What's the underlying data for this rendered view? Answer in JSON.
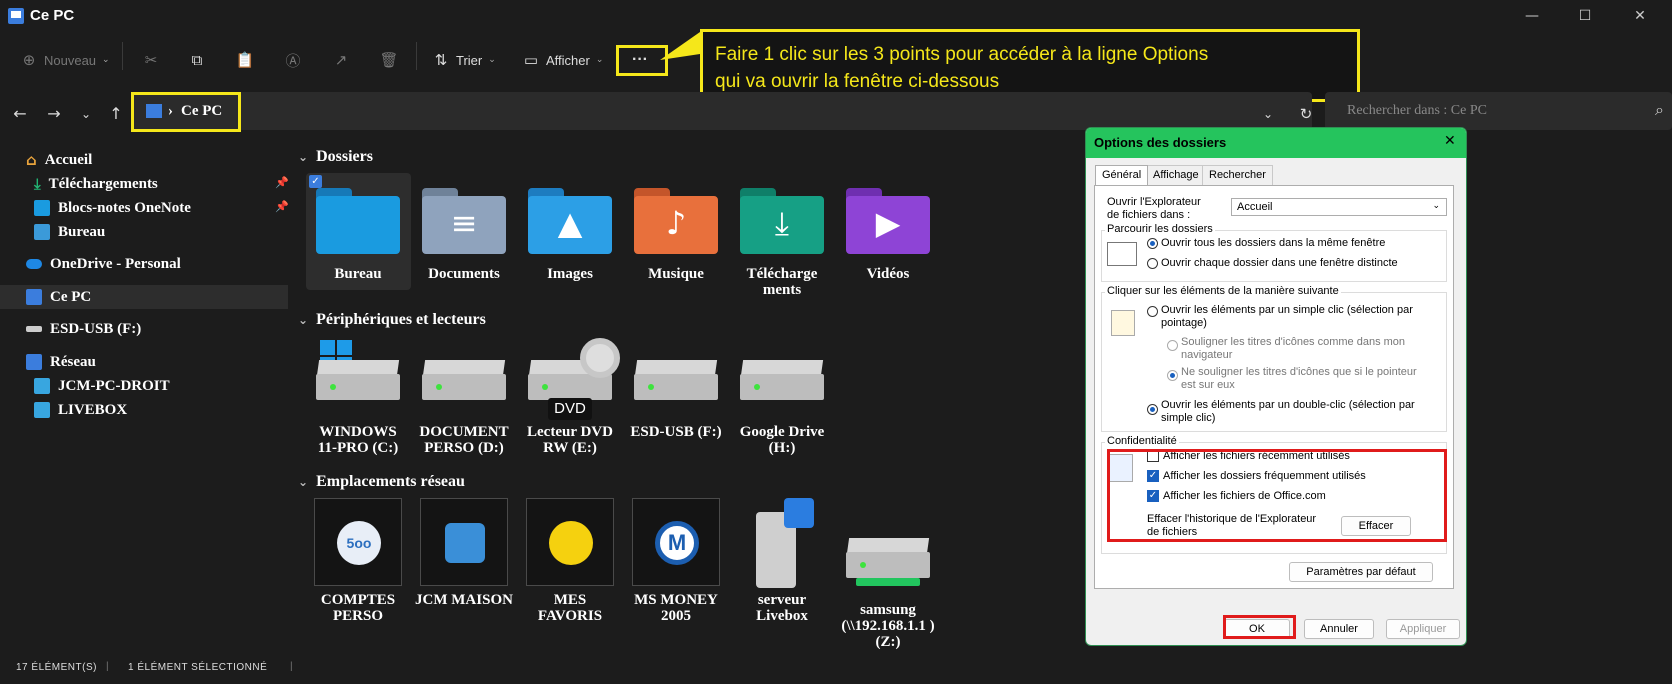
{
  "window": {
    "title": "Ce PC",
    "minimize": "—",
    "maximize": "☐",
    "close": "✕"
  },
  "toolbar": {
    "new_label": "Nouveau",
    "sort_label": "Trier",
    "view_label": "Afficher",
    "more_label": "···"
  },
  "address": {
    "separator": "›",
    "location": "Ce PC",
    "search_placeholder": "Rechercher dans : Ce PC"
  },
  "sidebar": {
    "items": [
      {
        "label": "Accueil"
      },
      {
        "label": "Téléchargements"
      },
      {
        "label": "Blocs-notes OneNote"
      },
      {
        "label": "Bureau"
      },
      {
        "label": "OneDrive - Personal"
      },
      {
        "label": "Ce PC"
      },
      {
        "label": "ESD-USB (F:)"
      },
      {
        "label": "Réseau"
      },
      {
        "label": "JCM-PC-DROIT"
      },
      {
        "label": "LIVEBOX"
      }
    ]
  },
  "sections": {
    "folders_title": "Dossiers",
    "devices_title": "Périphériques et lecteurs",
    "network_title": "Emplacements réseau"
  },
  "folders": [
    {
      "label": "Bureau",
      "color": "#1a9be0"
    },
    {
      "label": "Documents",
      "color": "#8fa3bd"
    },
    {
      "label": "Images",
      "color": "#2c9fe6"
    },
    {
      "label": "Musique",
      "color": "#e8703c"
    },
    {
      "label": "Télécharge ments",
      "color": "#16a085"
    },
    {
      "label": "Vidéos",
      "color": "#8e44d6"
    }
  ],
  "drives": [
    {
      "label": "WINDOWS 11-PRO (C:)"
    },
    {
      "label": "DOCUMENT PERSO (D:)"
    },
    {
      "label": "Lecteur DVD RW (E:)",
      "badge": "DVD"
    },
    {
      "label": "ESD-USB (F:)"
    },
    {
      "label": "Google Drive (H:)"
    }
  ],
  "network": [
    {
      "label": "COMPTES PERSO",
      "logo_text": "5oo"
    },
    {
      "label": "JCM MAISON"
    },
    {
      "label": "MES FAVORIS"
    },
    {
      "label": "MS MONEY 2005",
      "logo_text": "M"
    },
    {
      "label": "serveur Livebox"
    },
    {
      "label": "samsung (\\\\192.168.1.1 ) (Z:)"
    }
  ],
  "status": {
    "count": "17 élément(s)",
    "selected": "1 élément sélectionné"
  },
  "callout": {
    "line1": "Faire 1 clic sur les 3 points pour accéder à la ligne Options",
    "line2": "qui va ouvrir la fenêtre ci-dessous"
  },
  "dialog": {
    "title": "Options des dossiers",
    "tabs": [
      "Général",
      "Affichage",
      "Rechercher"
    ],
    "open_explorer_label_1": "Ouvrir l'Explorateur",
    "open_explorer_label_2": "de fichiers dans :",
    "open_explorer_value": "Accueil",
    "browse_group": "Parcourir les dossiers",
    "browse_same": "Ouvrir tous les dossiers dans la même fenêtre",
    "browse_new": "Ouvrir chaque dossier dans une fenêtre distincte",
    "click_group": "Cliquer sur les éléments de la manière suivante",
    "single_click_1": "Ouvrir les éléments par un simple clic (sélection par",
    "single_click_2": "pointage)",
    "underline_browser_1": "Souligner les titres d'icônes comme dans mon",
    "underline_browser_2": "navigateur",
    "underline_hover_1": "Ne souligner les titres d'icônes que si le pointeur",
    "underline_hover_2": "est sur eux",
    "double_click_1": "Ouvrir les éléments par un double-clic (sélection par",
    "double_click_2": "simple clic)",
    "privacy_group": "Confidentialité",
    "privacy_recent": "Afficher les fichiers récemment utilisés",
    "privacy_frequent": "Afficher les dossiers fréquemment utilisés",
    "privacy_office": "Afficher les fichiers de Office.com",
    "clear_history_1": "Effacer l'historique de l'Explorateur",
    "clear_history_2": "de fichiers",
    "clear_button": "Effacer",
    "defaults_button": "Paramètres par défaut",
    "ok": "OK",
    "cancel": "Annuler",
    "apply": "Appliquer"
  },
  "colors": {
    "highlight_yellow": "#f5e71a",
    "highlight_red": "#e01b1b",
    "dialog_title": "#25c45d"
  }
}
